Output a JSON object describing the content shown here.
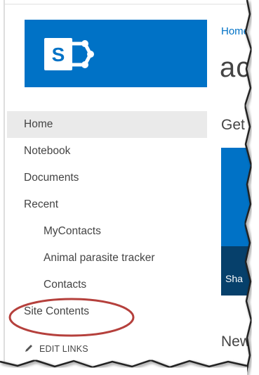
{
  "breadcrumb": {
    "label": "Home"
  },
  "site_title": "ac",
  "main": {
    "get_started_heading": "Get",
    "share_tile_label": "Sha",
    "news_heading": "New"
  },
  "nav": {
    "items": [
      {
        "label": "Home",
        "selected": true
      },
      {
        "label": "Notebook"
      },
      {
        "label": "Documents"
      },
      {
        "label": "Recent"
      },
      {
        "label": "MyContacts"
      },
      {
        "label": "Animal parasite tracker"
      },
      {
        "label": "Contacts"
      },
      {
        "label": "Site Contents"
      }
    ],
    "edit_links": "EDIT LINKS"
  },
  "colors": {
    "brand_blue": "#0072c6",
    "dark_blue": "#06406b",
    "annotation_red": "#b5403c",
    "nav_selected_bg": "#eaeaea"
  }
}
